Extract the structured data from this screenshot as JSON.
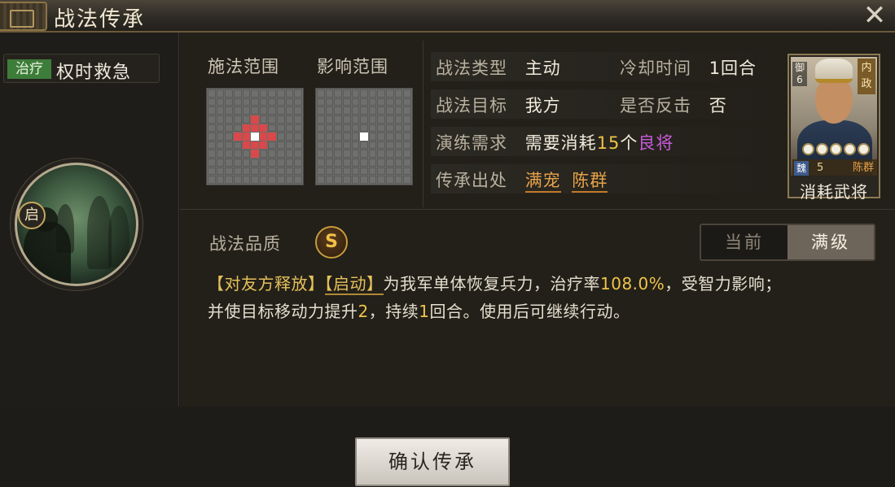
{
  "window": {
    "title": "战法传承"
  },
  "skill": {
    "type_tag": "治疗",
    "name": "权时救急",
    "badge": "启"
  },
  "range": {
    "cast_label": "施法范围",
    "effect_label": "影响范围"
  },
  "info": {
    "type_label": "战法类型",
    "type_value": "主动",
    "cooldown_label": "冷却时间",
    "cooldown_value": "1回合",
    "target_label": "战法目标",
    "target_value": "我方",
    "counter_label": "是否反击",
    "counter_value": "否",
    "train_label": "演练需求",
    "train_prefix": "需要消耗",
    "train_count": "15",
    "train_unit": "个",
    "train_grade": "良将",
    "origin_label": "传承出处",
    "origin_link1": "满宠",
    "origin_link2": "陈群"
  },
  "card": {
    "tag": "内政",
    "troop": "御",
    "troop_level": "6",
    "faction": "魏",
    "cost": "5",
    "general_name": "陈群",
    "caption": "消耗武将",
    "stars": 5
  },
  "quality": {
    "label": "战法品质",
    "grade": "S"
  },
  "toggle": {
    "current": "当前",
    "max": "满级"
  },
  "description": {
    "tag1": "【对友方释放】",
    "tag2": "【启动】",
    "part1": "为我军单体恢复兵力，治疗率",
    "heal_rate": "108.0%",
    "part2": "，受智力影响；",
    "part3": "并使目标移动力提升",
    "move_boost": "2",
    "part4": "，持续",
    "duration": "1",
    "part5": "回合。使用后可继续行动。"
  },
  "buttons": {
    "confirm": "确认传承"
  },
  "colors": {
    "accent_gold": "#f0c24a",
    "grade_purple": "#c75ad8",
    "link_orange": "#e7a24a",
    "heal_green": "#3d7d3a",
    "range_red": "#d9484a"
  }
}
